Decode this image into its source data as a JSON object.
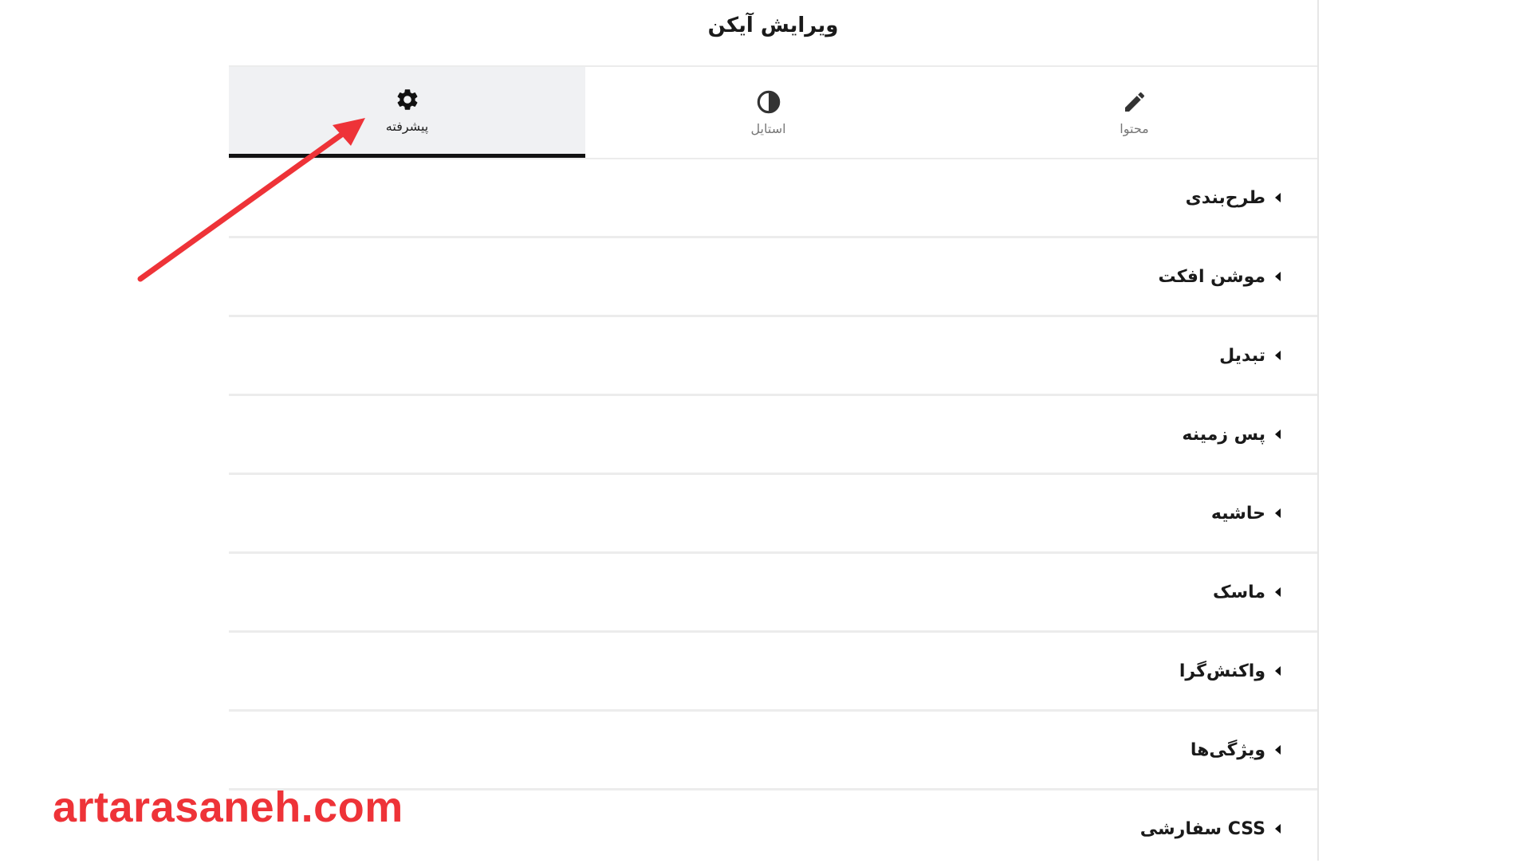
{
  "header": {
    "title": "ویرایش آیکن"
  },
  "tabs": [
    {
      "label": "پیشرفته",
      "icon": "gear-icon",
      "active": true
    },
    {
      "label": "استایل",
      "icon": "half-circle-icon",
      "active": false
    },
    {
      "label": "محتوا",
      "icon": "pencil-icon",
      "active": false
    }
  ],
  "sections": [
    {
      "label": "طرح‌بندی"
    },
    {
      "label": "موشن افکت"
    },
    {
      "label": "تبدیل"
    },
    {
      "label": "پس زمینه"
    },
    {
      "label": "حاشیه"
    },
    {
      "label": "ماسک"
    },
    {
      "label": "واکنش‌گرا"
    },
    {
      "label": "ویژگی‌ها"
    },
    {
      "label": "CSS سفارشی"
    }
  ],
  "watermark": "artarasaneh.com",
  "colors": {
    "accent_red": "#ee3338",
    "active_tab_bg": "#f0f1f3",
    "divider": "#ececec"
  }
}
